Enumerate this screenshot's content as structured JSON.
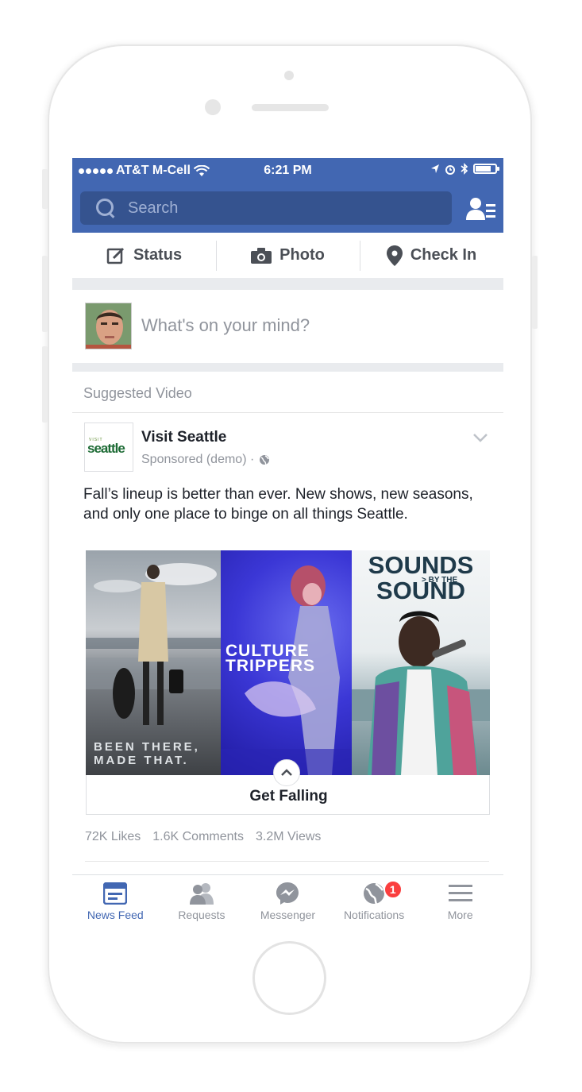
{
  "status_bar": {
    "carrier": "AT&T M-Cell",
    "time": "6:21 PM"
  },
  "search": {
    "placeholder": "Search"
  },
  "composer": {
    "actions": [
      {
        "label": "Status",
        "icon": "edit-icon"
      },
      {
        "label": "Photo",
        "icon": "camera-icon"
      },
      {
        "label": "Check In",
        "icon": "location-pin-icon"
      }
    ],
    "prompt": "What's on your mind?"
  },
  "post": {
    "section_label": "Suggested Video",
    "page_name": "Visit Seattle",
    "logo_small": "VISIT",
    "logo_text": "seattle",
    "sponsored": "Sponsored (demo) ·",
    "text": "Fall’s lineup is better than ever. New shows, new seasons, and only one place to binge on all things Seattle.",
    "panels": [
      {
        "caption_line1": "BEEN THERE,",
        "caption_line2": "MADE THAT."
      },
      {
        "caption_line1": "CULTURE",
        "caption_line2": "TRIPPERS"
      },
      {
        "title_line1": "SOUNDS",
        "sub": "> BY THE",
        "title_line2": "SOUND"
      }
    ],
    "cta": "Get Falling",
    "stats": {
      "likes": "72K Likes",
      "comments": "1.6K Comments",
      "views": "3.2M Views"
    }
  },
  "tabbar": {
    "tabs": [
      {
        "label": "News Feed",
        "icon": "news-feed-icon",
        "active": true
      },
      {
        "label": "Requests",
        "icon": "friend-requests-icon",
        "active": false
      },
      {
        "label": "Messenger",
        "icon": "messenger-icon",
        "active": false
      },
      {
        "label": "Notifications",
        "icon": "globe-icon",
        "active": false,
        "badge": "1"
      },
      {
        "label": "More",
        "icon": "hamburger-icon",
        "active": false
      }
    ]
  },
  "colors": {
    "brand": "#4267b2",
    "badge": "#fa3e3e"
  }
}
